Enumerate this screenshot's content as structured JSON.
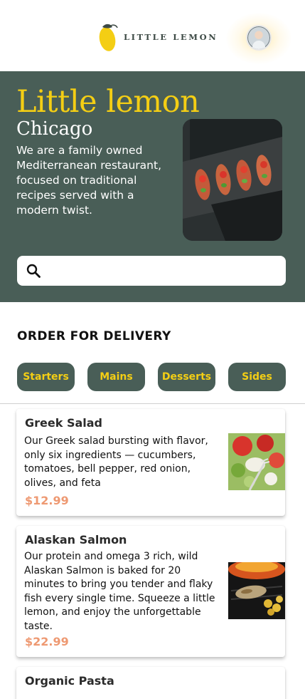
{
  "header": {
    "logo_text": "LITTLE LEMON",
    "logo_icon": "lemon-icon",
    "avatar_icon": "user-avatar"
  },
  "hero": {
    "title": "Little lemon",
    "city": "Chicago",
    "description": "We are a family owned Mediterranean restaurant, focused on traditional recipes served with a modern twist.",
    "search_placeholder": "",
    "search_icon": "search-icon"
  },
  "order": {
    "title": "ORDER FOR DELIVERY",
    "categories": [
      "Starters",
      "Mains",
      "Desserts",
      "Sides"
    ]
  },
  "menu": [
    {
      "name": "Greek Salad",
      "description": "Our Greek salad bursting with flavor, only six ingredients — cucumbers, tomatoes, bell pepper, red onion, olives, and feta",
      "price": "$12.99"
    },
    {
      "name": "Alaskan Salmon",
      "description": "Our protein and omega 3 rich, wild Alaskan Salmon  is baked for 20 minutes to  bring you tender and flaky fish every single time. Squeeze a little lemon, and enjoy the unforgettable taste.",
      "price": "$22.99"
    },
    {
      "name": "Organic Pasta"
    }
  ],
  "colors": {
    "primary_green": "#495e57",
    "primary_yellow": "#f4ce14",
    "price_accent": "#ee9972"
  }
}
